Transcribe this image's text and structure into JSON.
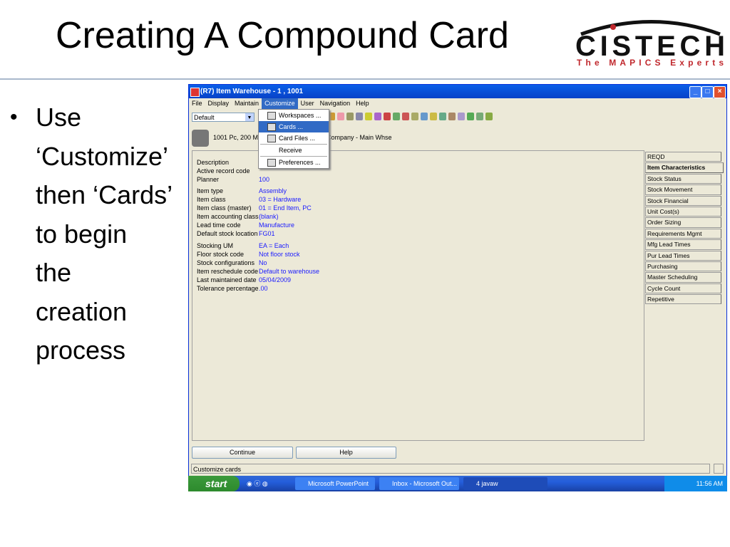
{
  "slide": {
    "title": "Creating A Compound Card",
    "bullet_lines": [
      "Use",
      "‘Customize’",
      "then ‘Cards’",
      "to begin",
      "the",
      "creation",
      "process"
    ],
    "logo": {
      "name": "CISTECH",
      "tagline": "The MAPICS Experts"
    }
  },
  "window": {
    "title": "(R7) Item Warehouse - 1 , 1001",
    "menu": [
      "File",
      "Display",
      "Maintain",
      "Customize",
      "User",
      "Navigation",
      "Help"
    ],
    "workspace_select": "Default",
    "item_header": "1001  Pc, 200 M",
    "item_header_right": "Company - Main Whse",
    "customize_menu": [
      "Workspaces ...",
      "Cards ...",
      "Card Files ...",
      "Receive",
      "Preferences ..."
    ],
    "fields": [
      {
        "label": "Description",
        "value": ""
      },
      {
        "label": "Active record code",
        "value": ""
      },
      {
        "label": "Planner",
        "value": "100"
      },
      {
        "label": "Item type",
        "value": "Assembly"
      },
      {
        "label": "Item class",
        "value": "03 = Hardware"
      },
      {
        "label": "Item class (master)",
        "value": "01 = End Item, PC"
      },
      {
        "label": "Item accounting class",
        "value": "(blank)"
      },
      {
        "label": "Lead time code",
        "value": "Manufacture"
      },
      {
        "label": "Default stock location",
        "value": "FG01"
      },
      {
        "label": "Stocking UM",
        "value": "EA = Each"
      },
      {
        "label": "Floor stock code",
        "value": "Not floor stock"
      },
      {
        "label": "Stock configurations",
        "value": "No"
      },
      {
        "label": "Item reschedule code",
        "value": "Default to warehouse"
      },
      {
        "label": "Last maintained date",
        "value": "05/04/2009"
      },
      {
        "label": "Tolerance percentage",
        "value": ".00"
      }
    ],
    "tabs": [
      "REQD",
      "Item Characteristics",
      "Stock Status",
      "Stock Movement",
      "Stock Financial",
      "Unit Cost(s)",
      "Order Sizing",
      "Requirements Mgmt",
      "Mfg Lead Times",
      "Pur Lead Times",
      "Purchasing",
      "Master Scheduling",
      "Cycle Count",
      "Repetitive"
    ],
    "selected_tab": "Item Characteristics",
    "buttons": {
      "continue": "Continue",
      "help": "Help"
    },
    "status": "Customize cards"
  },
  "taskbar": {
    "start": "start",
    "items": [
      "Microsoft PowerPoint ...",
      "Inbox - Microsoft Out...",
      "4 javaw"
    ],
    "clock": "11:56 AM"
  },
  "colors": {
    "titlebar": "#0a5fe8",
    "menu_highlight": "#316ac5",
    "field_value": "#1a1aff",
    "rule": "#a9b8cc"
  }
}
